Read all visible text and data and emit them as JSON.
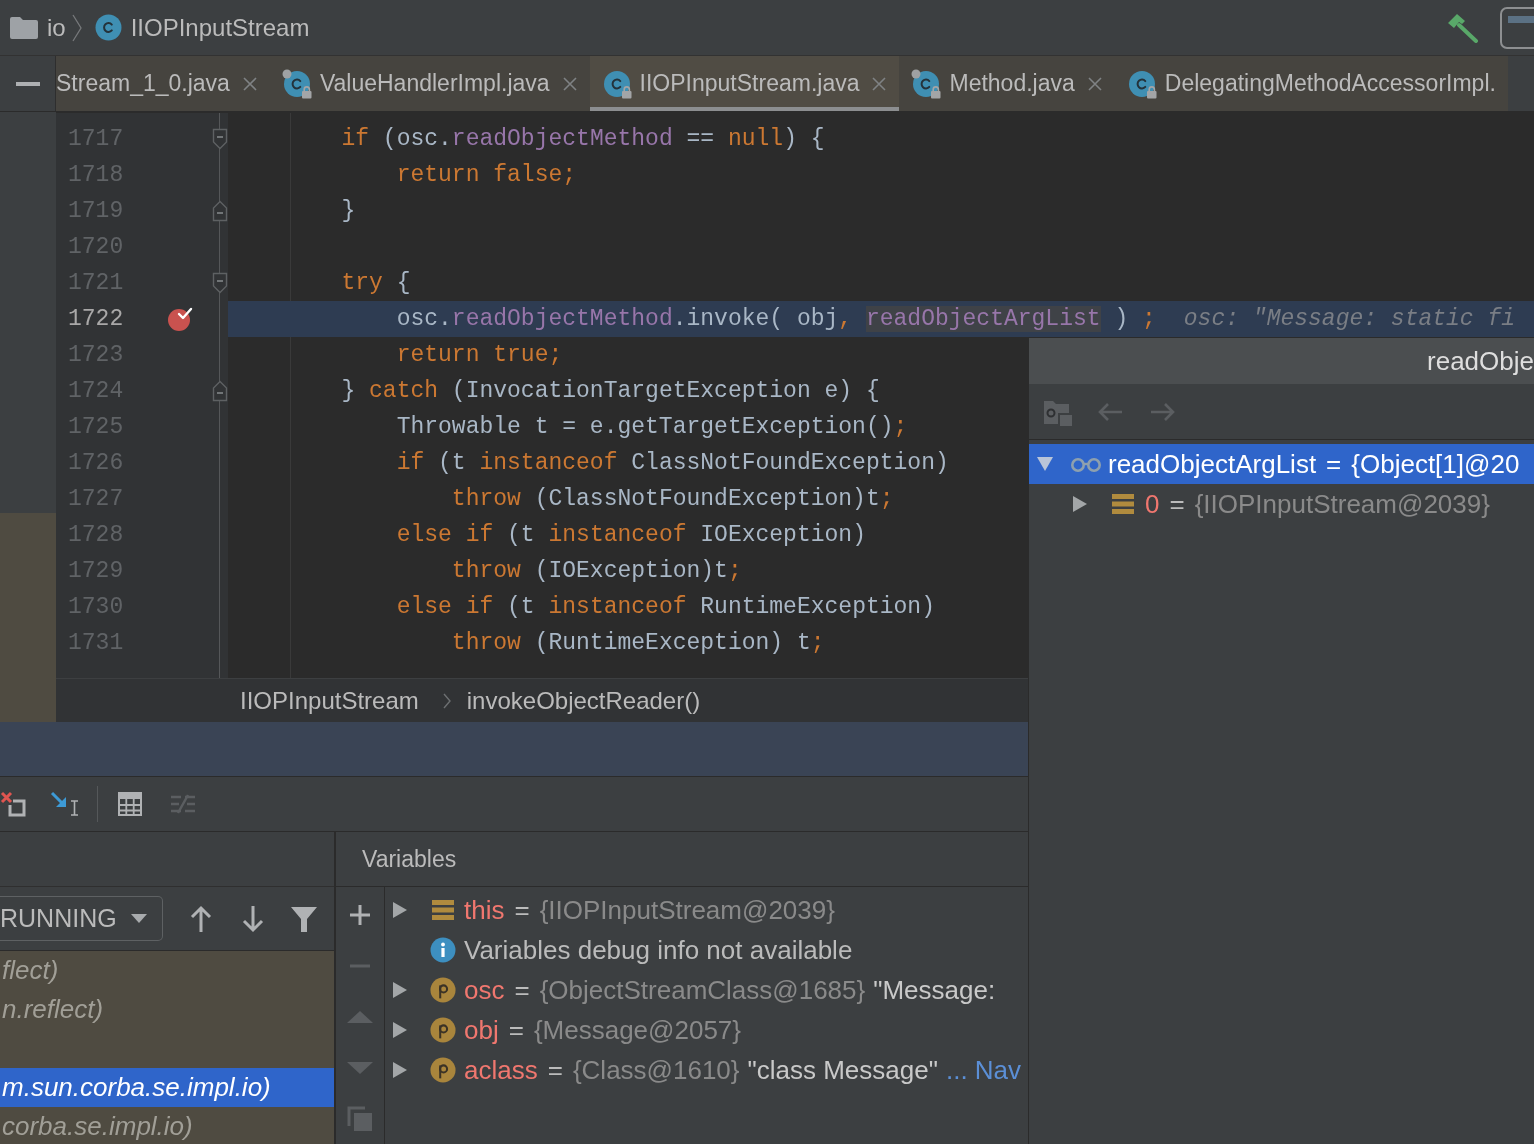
{
  "navigation_bar": {
    "crumbs": [
      {
        "kind": "folder",
        "label": "io"
      },
      {
        "kind": "class",
        "label": "IIOPInputStream"
      }
    ]
  },
  "tabs": [
    {
      "label": "Stream_1_0.java",
      "kind": "plain",
      "closable": true,
      "selected": false
    },
    {
      "label": "ValueHandlerImpl.java",
      "kind": "class",
      "pinned": true,
      "read_only": true,
      "closable": true,
      "selected": false
    },
    {
      "label": "IIOPInputStream.java",
      "kind": "class",
      "pinned": false,
      "read_only": true,
      "closable": true,
      "selected": true
    },
    {
      "label": "Method.java",
      "kind": "class",
      "pinned": true,
      "read_only": true,
      "closable": true,
      "selected": false
    },
    {
      "label": "DelegatingMethodAccessorImpl.",
      "kind": "class",
      "pinned": false,
      "read_only": true,
      "closable": false,
      "selected": false
    }
  ],
  "editor": {
    "lines": [
      {
        "number": "1717",
        "fold": {
          "kind": "start"
        },
        "breakpoint": false,
        "current": false,
        "tokens": [
          {
            "kind": "keyword",
            "text": "        if"
          },
          {
            "kind": "text",
            "text": " (osc."
          },
          {
            "kind": "field",
            "text": "readObjectMethod"
          },
          {
            "kind": "text",
            "text": " == "
          },
          {
            "kind": "keyword",
            "text": "null"
          },
          {
            "kind": "text",
            "text": ") {"
          }
        ]
      },
      {
        "number": "1718",
        "breakpoint": false,
        "current": false,
        "tokens": [
          {
            "kind": "keyword",
            "text": "            return false;"
          }
        ]
      },
      {
        "number": "1719",
        "fold": {
          "kind": "end"
        },
        "breakpoint": false,
        "current": false,
        "tokens": [
          {
            "kind": "text",
            "text": "        }"
          }
        ]
      },
      {
        "number": "1720",
        "breakpoint": false,
        "current": false
      },
      {
        "number": "1721",
        "fold": {
          "kind": "start"
        },
        "breakpoint": false,
        "current": false,
        "tokens": [
          {
            "kind": "keyword",
            "text": "        try"
          },
          {
            "kind": "text",
            "text": " {"
          }
        ]
      },
      {
        "number": "1722",
        "breakpoint": true,
        "current": true,
        "tokens": [
          {
            "kind": "text",
            "text": "            osc."
          },
          {
            "kind": "field",
            "text": "readObjectMethod"
          },
          {
            "kind": "text",
            "text": ".invoke( obj"
          },
          {
            "kind": "keyword",
            "text": ", "
          },
          {
            "kind": "hovered",
            "text": "readObjectArgList"
          },
          {
            "kind": "text",
            "text": " ) "
          },
          {
            "kind": "keyword",
            "text": ";"
          }
        ],
        "hint": "osc: \"Message: static fi"
      },
      {
        "number": "1723",
        "breakpoint": false,
        "current": false,
        "tokens": [
          {
            "kind": "keyword",
            "text": "            return true;"
          }
        ]
      },
      {
        "number": "1724",
        "fold": {
          "kind": "end"
        },
        "breakpoint": false,
        "current": false,
        "tokens": [
          {
            "kind": "text",
            "text": "        } "
          },
          {
            "kind": "keyword",
            "text": "catch"
          },
          {
            "kind": "text",
            "text": " (InvocationTargetException e) {"
          }
        ]
      },
      {
        "number": "1725",
        "breakpoint": false,
        "current": false,
        "tokens": [
          {
            "kind": "text",
            "text": "            Throwable t = e.getTargetException()"
          },
          {
            "kind": "keyword",
            "text": ";"
          }
        ]
      },
      {
        "number": "1726",
        "breakpoint": false,
        "current": false,
        "tokens": [
          {
            "kind": "keyword",
            "text": "            if"
          },
          {
            "kind": "text",
            "text": " (t "
          },
          {
            "kind": "keyword",
            "text": "instanceof"
          },
          {
            "kind": "text",
            "text": " ClassNotFoundException)"
          }
        ]
      },
      {
        "number": "1727",
        "breakpoint": false,
        "current": false,
        "tokens": [
          {
            "kind": "keyword",
            "text": "                throw"
          },
          {
            "kind": "text",
            "text": " (ClassNotFoundException)t"
          },
          {
            "kind": "keyword",
            "text": ";"
          }
        ]
      },
      {
        "number": "1728",
        "breakpoint": false,
        "current": false,
        "tokens": [
          {
            "kind": "keyword",
            "text": "            else if"
          },
          {
            "kind": "text",
            "text": " (t "
          },
          {
            "kind": "keyword",
            "text": "instanceof"
          },
          {
            "kind": "text",
            "text": " IOException)"
          }
        ]
      },
      {
        "number": "1729",
        "breakpoint": false,
        "current": false,
        "tokens": [
          {
            "kind": "keyword",
            "text": "                throw"
          },
          {
            "kind": "text",
            "text": " (IOException)t"
          },
          {
            "kind": "keyword",
            "text": ";"
          }
        ]
      },
      {
        "number": "1730",
        "breakpoint": false,
        "current": false,
        "tokens": [
          {
            "kind": "keyword",
            "text": "            else if"
          },
          {
            "kind": "text",
            "text": " (t "
          },
          {
            "kind": "keyword",
            "text": "instanceof"
          },
          {
            "kind": "text",
            "text": " RuntimeException)"
          }
        ]
      },
      {
        "number": "1731",
        "breakpoint": false,
        "current": false,
        "tokens": [
          {
            "kind": "keyword",
            "text": "                throw"
          },
          {
            "kind": "text",
            "text": " (RuntimeException) t"
          },
          {
            "kind": "keyword",
            "text": ";"
          }
        ]
      }
    ],
    "breadcrumbs": [
      "IIOPInputStream",
      "invokeObjectReader()"
    ]
  },
  "popup": {
    "title": "readObje",
    "toolbar": [
      {
        "kind": "folder",
        "disabled": true
      },
      {
        "kind": "back",
        "disabled": true
      },
      {
        "kind": "forward",
        "disabled": true
      }
    ],
    "tree": [
      {
        "kind": "watch",
        "name": "readObjectArgList",
        "operator": "=",
        "value": "{Object[1]@20",
        "expanded": true,
        "selected": true,
        "children": [
          {
            "kind": "field",
            "name": "0",
            "operator": "=",
            "value": "{IIOPInputStream@2039}",
            "expanded": false,
            "selected": false
          }
        ]
      }
    ]
  },
  "debug_toolbar": [
    {
      "kind": "close-frames",
      "disabled": false
    },
    {
      "kind": "drop-frame",
      "disabled": false
    },
    {
      "kind": "separator"
    },
    {
      "kind": "evaluate",
      "disabled": false
    },
    {
      "kind": "trace",
      "disabled": true
    }
  ],
  "frames": {
    "thread_filter": "RUNNING",
    "toolbar": [
      {
        "kind": "up",
        "disabled": false
      },
      {
        "kind": "down",
        "disabled": false
      },
      {
        "kind": "filter",
        "disabled": false
      }
    ],
    "items": [
      {
        "text": "flect)",
        "selected": false
      },
      {
        "text": "n.reflect)",
        "selected": false
      },
      {
        "selected": false
      },
      {
        "text": "m.sun.corba.se.impl.io)",
        "selected": true
      },
      {
        "text": "corba.se.impl.io)",
        "selected": false
      }
    ]
  },
  "variables": {
    "title": "Variables",
    "toolbar": [
      {
        "kind": "add",
        "disabled": false
      },
      {
        "kind": "remove",
        "disabled": true
      },
      {
        "kind": "up",
        "disabled": true
      },
      {
        "kind": "down",
        "disabled": true
      },
      {
        "kind": "copy",
        "disabled": true
      }
    ],
    "rows": [
      {
        "kind": "field",
        "name": "this",
        "operator": "=",
        "value": "{IIOPInputStream@2039}",
        "expanded": false
      },
      {
        "kind": "info",
        "message": "Variables debug info not available"
      },
      {
        "kind": "parameter",
        "name": "osc",
        "operator": "=",
        "value": "{ObjectStreamClass@1685}",
        "string": "\"Message:",
        "expanded": false
      },
      {
        "kind": "parameter",
        "name": "obj",
        "operator": "=",
        "value": "{Message@2057}",
        "expanded": false
      },
      {
        "kind": "parameter",
        "name": "aclass",
        "operator": "=",
        "value": "{Class@1610}",
        "string": "\"class Message\"",
        "link": "... Nav",
        "expanded": false
      }
    ]
  }
}
